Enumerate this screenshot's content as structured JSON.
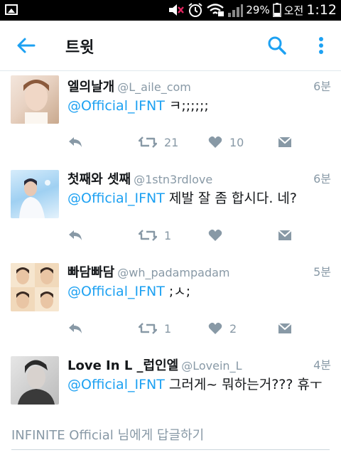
{
  "status_bar": {
    "battery": "29%",
    "ampm": "오전",
    "time": "1:12"
  },
  "header": {
    "title": "트윗"
  },
  "tweets": [
    {
      "name": "엘의날개",
      "handle": "@L_aile_com",
      "time": "6분",
      "mention": "@Official_IFNT",
      "text": " ㅋ;;;;;;",
      "retweets": "21",
      "likes": "10"
    },
    {
      "name": "첫째와 셋째",
      "handle": "@1stn3rdlove",
      "time": "6분",
      "mention": "@Official_IFNT",
      "text": " 제발 잘 좀 합시다. 네?",
      "retweets": "1",
      "likes": ""
    },
    {
      "name": "빠담빠담",
      "handle": "@wh_padampadam",
      "time": "5분",
      "mention": "@Official_IFNT",
      "text": " ;ㅅ;",
      "retweets": "1",
      "likes": "2"
    },
    {
      "name": "Love In L _럽인엘",
      "handle": "@Lovein_L",
      "time": "4분",
      "mention": "@Official_IFNT",
      "text": " 그러게~ 뭐하는거??? 휴ㅜ"
    }
  ],
  "reply_prompt": {
    "user": "INFINITE Official",
    "suffix": " 님에게 답글하기"
  },
  "colors": {
    "accent": "#1da1f2",
    "muted": "#8899a6",
    "divider": "#e1e8ed"
  }
}
